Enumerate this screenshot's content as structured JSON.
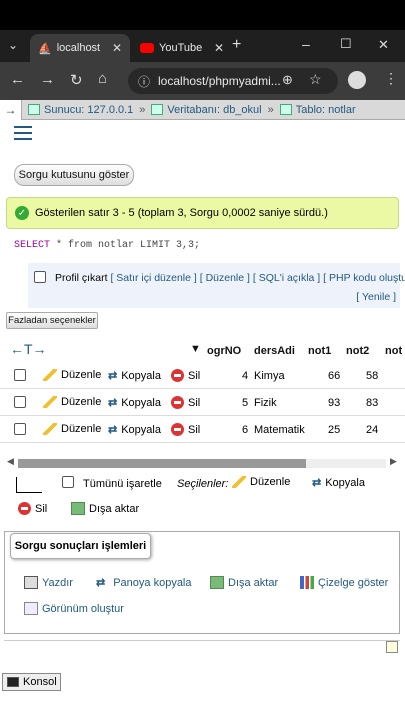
{
  "browser": {
    "tabs": [
      {
        "title": "localhost",
        "active": true
      },
      {
        "title": "YouTube",
        "active": false
      }
    ],
    "new_tab": "+",
    "url": "localhost/phpmyadmi...",
    "window_controls": [
      "–",
      "☐",
      "✕"
    ]
  },
  "breadcrumb": {
    "server": "Sunucu: 127.0.0.1",
    "database": "Veritabanı: db_okul",
    "table": "Tablo: notlar",
    "sep": "»"
  },
  "query_box_button": "Sorgu kutusunu göster",
  "success_message": "Gösterilen satır 3 - 5 (toplam 3, Sorgu 0,0002 saniye sürdü.)",
  "sql": {
    "keyword": "SELECT",
    "rest": " * from notlar LIMIT 3,3;"
  },
  "profil": {
    "label": "Profil çıkart",
    "links": [
      "[ Satır içi düzenle ]",
      "[ Düzenle ]",
      "[ SQL'i açıkla ]",
      "[ PHP kodu oluştur ]"
    ],
    "refresh": "[ Yenile ]"
  },
  "extra_options": "Fazladan seçenekler",
  "columns": [
    "ogrNO",
    "dersAdi",
    "not1",
    "not2",
    "not"
  ],
  "actions": {
    "edit": "Düzenle",
    "copy": "Kopyala",
    "delete": "Sil"
  },
  "rows": [
    {
      "ogrNO": "4",
      "dersAdi": "Kimya",
      "not1": "66",
      "not2": "58"
    },
    {
      "ogrNO": "5",
      "dersAdi": "Fizik",
      "not1": "93",
      "not2": "83"
    },
    {
      "ogrNO": "6",
      "dersAdi": "Matematik",
      "not1": "25",
      "not2": "24"
    }
  ],
  "bulk": {
    "check_all": "Tümünü işaretle",
    "selected": "Seçilenler:",
    "edit": "Düzenle",
    "copy": "Kopyala",
    "delete": "Sil",
    "export": "Dışa aktar"
  },
  "operations": {
    "title": "Sorgu sonuçları işlemleri",
    "print": "Yazdır",
    "clipboard": "Panoya kopyala",
    "export": "Dışa aktar",
    "chart": "Çizelge göster",
    "view": "Görünüm oluştur"
  },
  "console": "Konsol",
  "colors": {
    "link": "#235a81",
    "success_bg": "#ebf8a4",
    "delete": "#d33"
  }
}
